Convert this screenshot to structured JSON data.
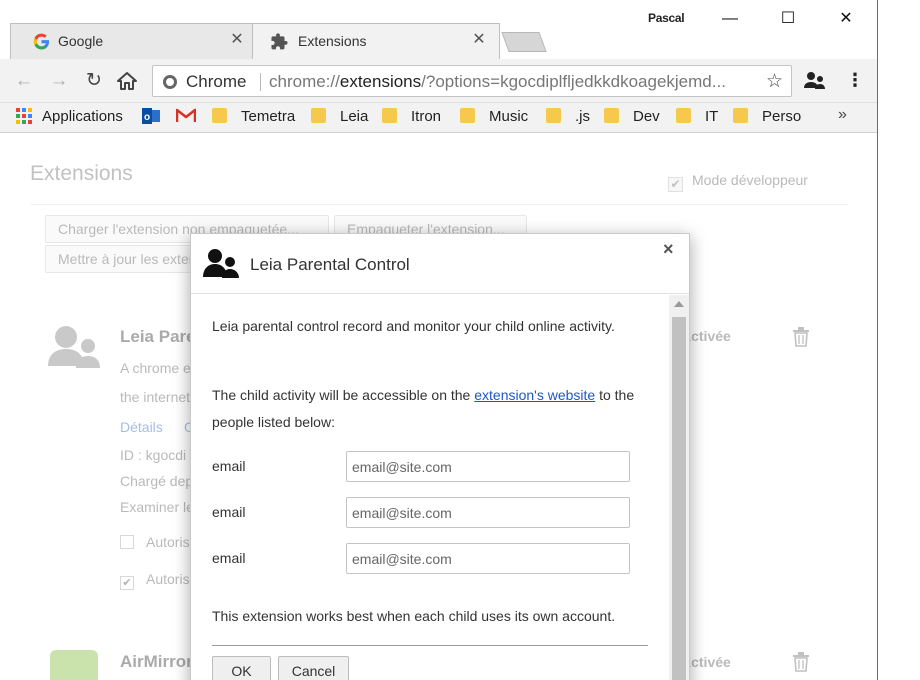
{
  "window": {
    "user_name": "Pascal",
    "minimize": "—",
    "maximize": "☐",
    "close": "✕"
  },
  "tabs": [
    {
      "title": "Google",
      "icon": "google-g-icon",
      "active": false
    },
    {
      "title": "Extensions",
      "icon": "puzzle-icon",
      "active": true
    }
  ],
  "toolbar": {
    "site_label": "Chrome",
    "url_prefix": "chrome://",
    "url_host": "extensions",
    "url_rest": "/?options=kgocdiplfljedkkdkoagekjemd...",
    "accent": "#444444"
  },
  "bookmarks": {
    "items": [
      {
        "label": "Applications",
        "icon": "apps-grid-icon"
      },
      {
        "label": "",
        "icon": "outlook-icon"
      },
      {
        "label": "",
        "icon": "gmail-icon"
      },
      {
        "label": "Temetra",
        "icon": "folder-icon"
      },
      {
        "label": "Leia",
        "icon": "folder-icon"
      },
      {
        "label": "Itron",
        "icon": "folder-icon"
      },
      {
        "label": "Music",
        "icon": "folder-icon"
      },
      {
        "label": ".js",
        "icon": "folder-icon"
      },
      {
        "label": "Dev",
        "icon": "folder-icon"
      },
      {
        "label": "IT",
        "icon": "folder-icon"
      },
      {
        "label": "Perso",
        "icon": "folder-icon"
      }
    ],
    "more": "»"
  },
  "page": {
    "title": "Extensions",
    "dev_mode_label": "Mode développeur",
    "buttons": {
      "load": "Charger l'extension non empaquetée...",
      "pack": "Empaqueter l'extension...",
      "update": "Mettre à jour les extensions"
    },
    "extensions": [
      {
        "name": "Leia Parental Control",
        "description": "A chrome extension",
        "description2": "the internet",
        "details": "Détails",
        "details2": "O",
        "id": "ID : kgocdi",
        "loaded": "Chargé depuis",
        "inspect": "Examiner les vues",
        "allow1": "Autoriser",
        "allow2": "Autoriser",
        "state": "Activée"
      },
      {
        "name": "AirMirror",
        "state": "Activée"
      }
    ]
  },
  "modal": {
    "title": "Leia Parental Control",
    "close": "×",
    "intro": "Leia parental control record and monitor your child online activity.",
    "access_before": "The child activity will be accessible on the ",
    "access_link": "extension's website",
    "access_after": " to the people listed below:",
    "emails": [
      {
        "label": "email",
        "placeholder": "email@site.com"
      },
      {
        "label": "email",
        "placeholder": "email@site.com"
      },
      {
        "label": "email",
        "placeholder": "email@site.com"
      }
    ],
    "note": "This extension works best when each child uses its own account.",
    "ok": "OK",
    "cancel": "Cancel",
    "link_color": "#1e56c8"
  }
}
